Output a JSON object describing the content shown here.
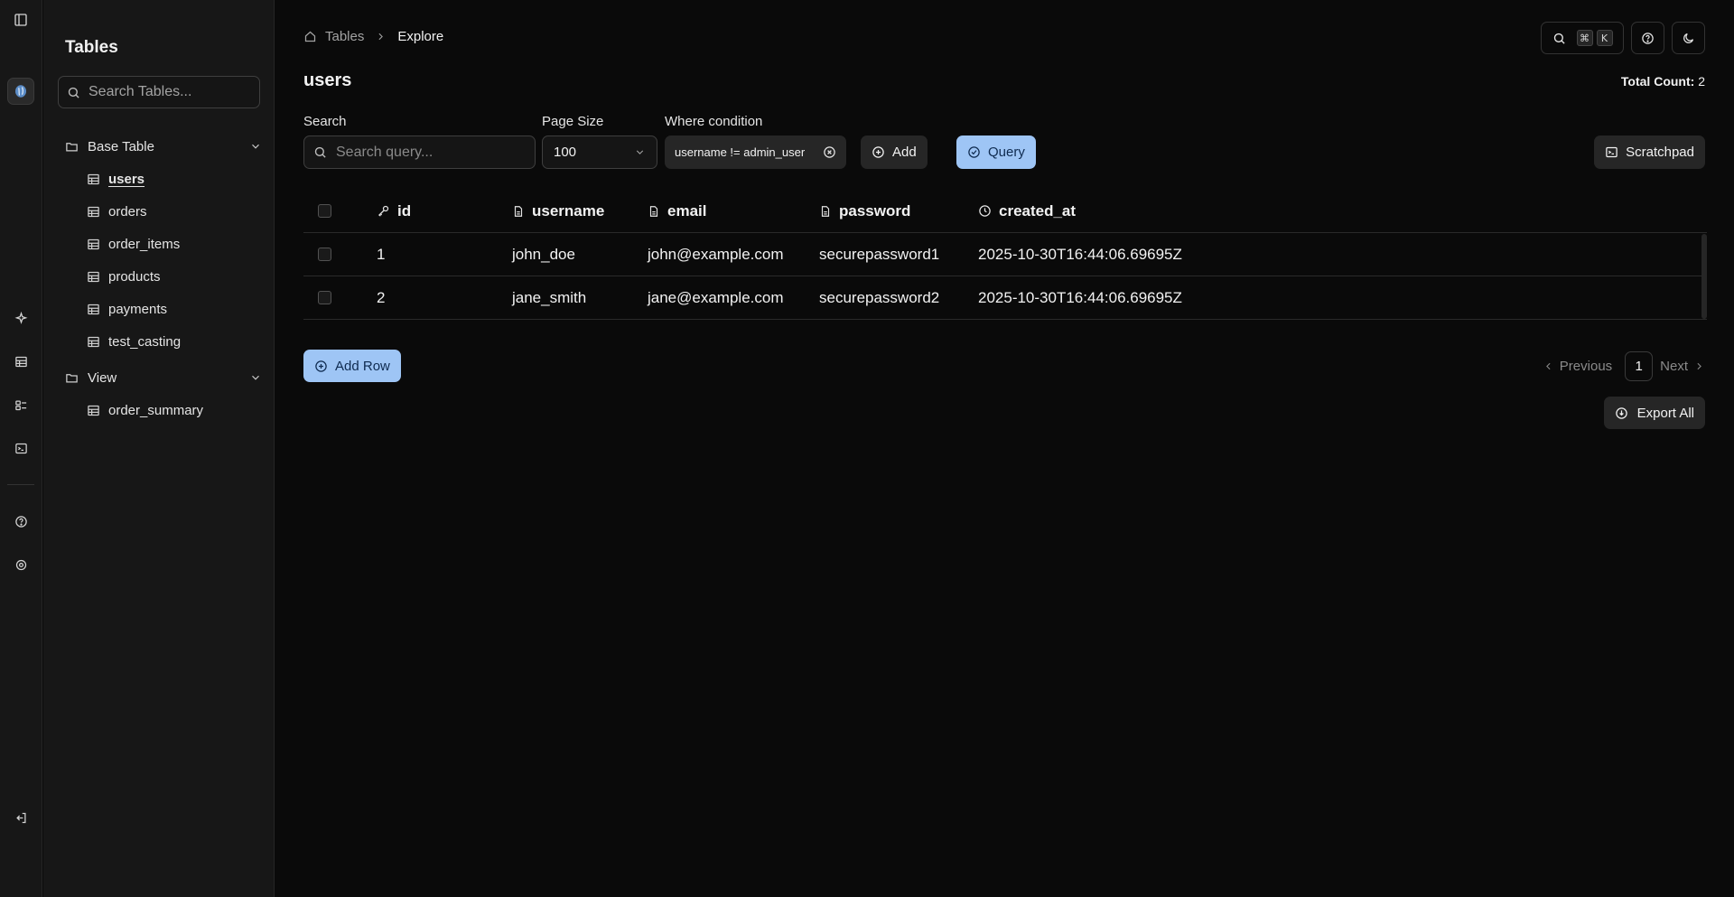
{
  "sidebar": {
    "title": "Tables",
    "search_placeholder": "Search Tables...",
    "groups": [
      {
        "label": "Base Table",
        "items": [
          "users",
          "orders",
          "order_items",
          "products",
          "payments",
          "test_casting"
        ]
      },
      {
        "label": "View",
        "items": [
          "order_summary"
        ]
      }
    ],
    "active_item": "users"
  },
  "breadcrumb": {
    "root": "Tables",
    "current": "Explore"
  },
  "shortcut": {
    "mod": "⌘",
    "key": "K"
  },
  "page": {
    "title": "users",
    "total_count_label": "Total Count:",
    "total_count_value": "2"
  },
  "filters": {
    "search_label": "Search",
    "search_placeholder": "Search query...",
    "page_size_label": "Page Size",
    "page_size_value": "100",
    "where_label": "Where condition",
    "where_value": "username != admin_user",
    "add_label": "Add",
    "query_label": "Query",
    "scratchpad_label": "Scratchpad"
  },
  "table": {
    "columns": [
      {
        "name": "id",
        "icon": "key-icon"
      },
      {
        "name": "username",
        "icon": "file-text-icon"
      },
      {
        "name": "email",
        "icon": "file-text-icon"
      },
      {
        "name": "password",
        "icon": "file-text-icon"
      },
      {
        "name": "created_at",
        "icon": "clock-icon"
      }
    ],
    "rows": [
      [
        "1",
        "john_doe",
        "john@example.com",
        "securepassword1",
        "2025-10-30T16:44:06.69695Z"
      ],
      [
        "2",
        "jane_smith",
        "jane@example.com",
        "securepassword2",
        "2025-10-30T16:44:06.69695Z"
      ]
    ]
  },
  "actions": {
    "add_row_label": "Add Row",
    "export_label": "Export All"
  },
  "pagination": {
    "previous": "Previous",
    "page": "1",
    "next": "Next"
  },
  "colors": {
    "accent": "#9ec5f5",
    "background": "#0a0a0a",
    "panel": "#171717"
  }
}
